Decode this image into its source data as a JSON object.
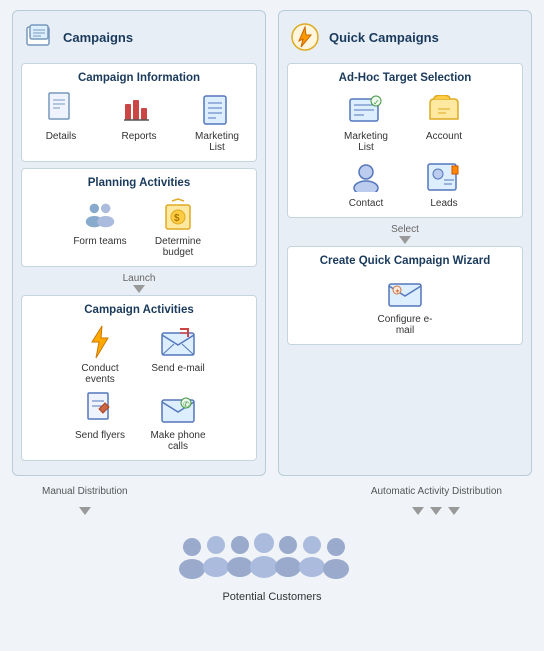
{
  "campaigns": {
    "title": "Campaigns",
    "campaign_information": {
      "title": "Campaign Information",
      "items": [
        {
          "label": "Details",
          "icon": "doc"
        },
        {
          "label": "Reports",
          "icon": "chart"
        },
        {
          "label": "Marketing List",
          "icon": "list"
        }
      ]
    },
    "planning_activities": {
      "title": "Planning Activities",
      "items": [
        {
          "label": "Form teams",
          "icon": "team"
        },
        {
          "label": "Determine budget",
          "icon": "budget"
        }
      ]
    },
    "launch_arrow_label": "Launch",
    "campaign_activities": {
      "title": "Campaign Activities",
      "items": [
        {
          "label": "Conduct events",
          "icon": "lightning"
        },
        {
          "label": "Send e-mail",
          "icon": "email"
        },
        {
          "label": "Send flyers",
          "icon": "flyer"
        },
        {
          "label": "Make phone calls",
          "icon": "phone"
        }
      ]
    }
  },
  "quick_campaigns": {
    "title": "Quick Campaigns",
    "adhoc": {
      "title": "Ad-Hoc Target Selection",
      "items": [
        {
          "label": "Marketing List",
          "icon": "mktlist"
        },
        {
          "label": "Account",
          "icon": "account"
        },
        {
          "label": "Contact",
          "icon": "contact"
        },
        {
          "label": "Leads",
          "icon": "leads"
        }
      ]
    },
    "select_arrow_label": "Select",
    "wizard": {
      "title": "Create Quick Campaign Wizard",
      "items": [
        {
          "label": "Configure e-mail",
          "icon": "configure"
        }
      ]
    }
  },
  "distribution": {
    "manual_label": "Manual Distribution",
    "automatic_label": "Automatic Activity Distribution",
    "customers_label": "Potential Customers"
  }
}
